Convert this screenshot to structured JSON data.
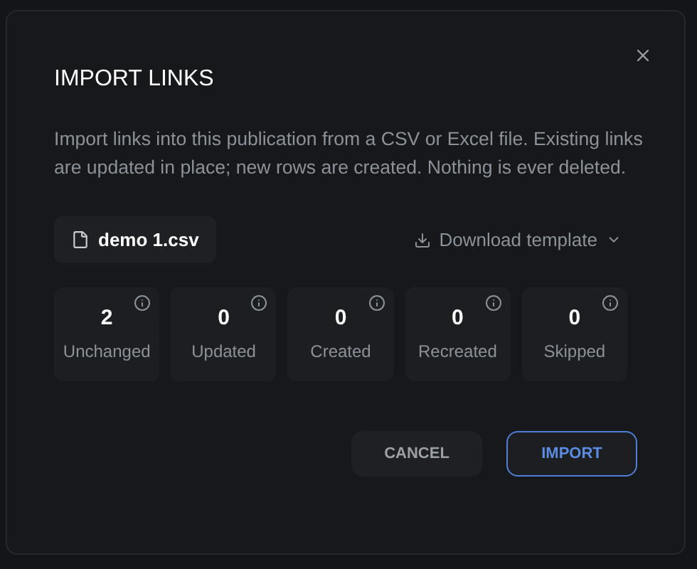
{
  "dialog": {
    "title": "IMPORT LINKS",
    "description": "Import links into this publication from a CSV or Excel file. Existing links are updated in place; new rows are created. Nothing is ever deleted.",
    "file": {
      "name": "demo 1.csv"
    },
    "download": {
      "label": "Download template"
    },
    "stats": [
      {
        "value": "2",
        "label": "Unchanged"
      },
      {
        "value": "0",
        "label": "Updated"
      },
      {
        "value": "0",
        "label": "Created"
      },
      {
        "value": "0",
        "label": "Recreated"
      },
      {
        "value": "0",
        "label": "Skipped"
      }
    ],
    "buttons": [
      {
        "label": "CANCEL",
        "kind": "secondary"
      },
      {
        "label": "IMPORT",
        "kind": "primary"
      }
    ]
  }
}
